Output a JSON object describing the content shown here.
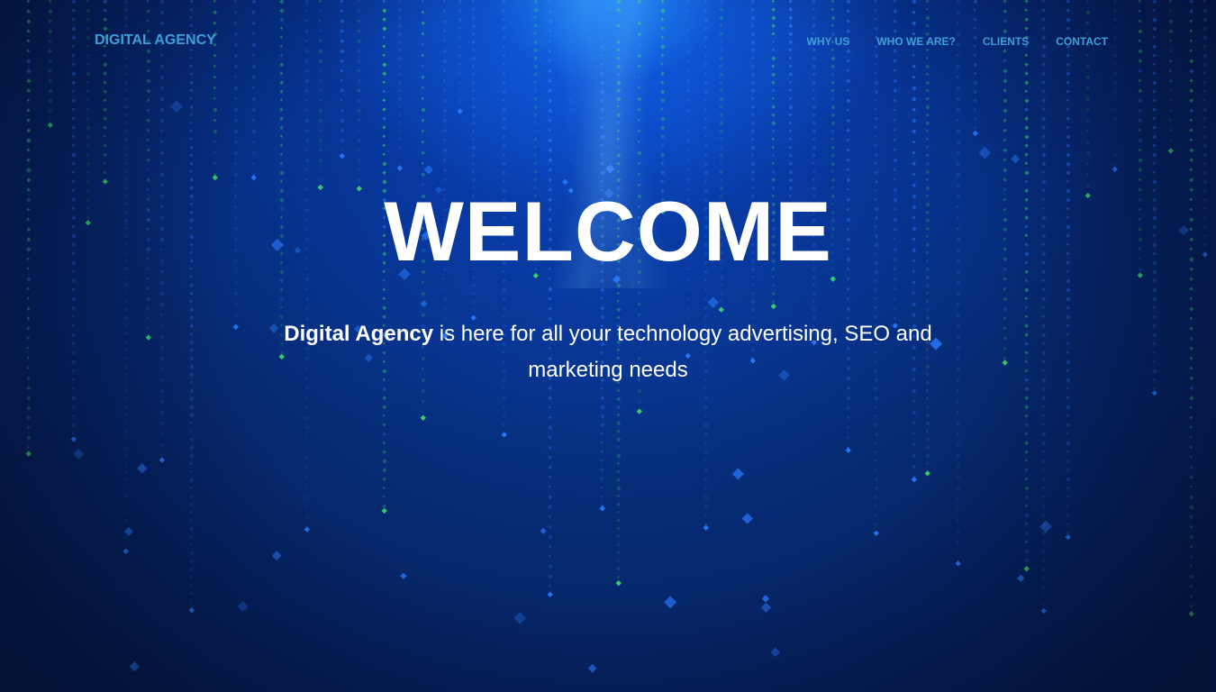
{
  "navbar": {
    "brand": "DIGITAL AGENCY",
    "links": [
      {
        "label": "WHY US"
      },
      {
        "label": "WHO WE ARE?"
      },
      {
        "label": "CLIENTS"
      },
      {
        "label": "CONTACT"
      }
    ]
  },
  "hero": {
    "title": "WELCOME",
    "text_bold": "Digital Agency",
    "text_rest": " is here for all your technology advertising, SEO and marketing needs"
  },
  "colors": {
    "nav_text": "#3e9ed8",
    "hero_text": "#ffffff",
    "background_dark": "#041a4a",
    "background_glow": "#2896ff",
    "rain_green": "#3ddc6a",
    "rain_blue": "#2a7cff"
  },
  "background": {
    "style": "digital-rain"
  }
}
